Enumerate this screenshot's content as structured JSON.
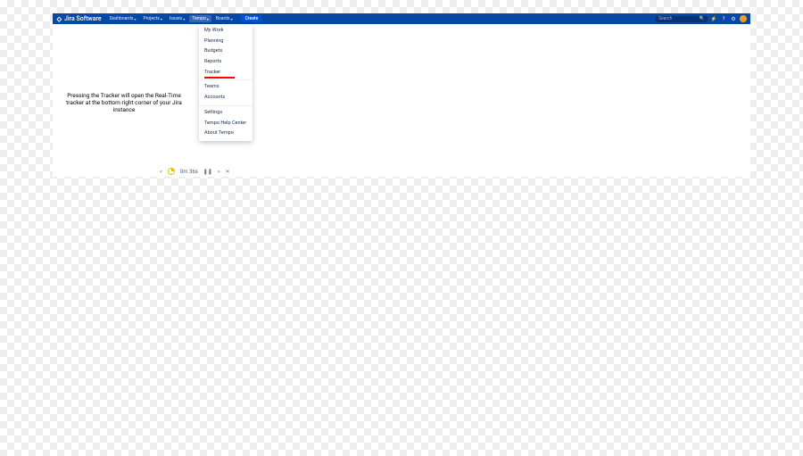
{
  "brand": "Jira Software",
  "nav": {
    "dashboards": "Dashboards",
    "projects": "Projects",
    "issues": "Issues",
    "tempo": "Tempo",
    "boards": "Boards"
  },
  "create": "Create",
  "search": {
    "placeholder": "Search"
  },
  "dropdown": {
    "my_work": "My Work",
    "planning": "Planning",
    "budgets": "Budgets",
    "reports": "Reports",
    "tracker": "Tracker",
    "teams": "Teams",
    "accounts": "Accounts",
    "settings": "Settings",
    "help_center": "Tempo Help Center",
    "about": "About Tempo"
  },
  "caption": "Pressing the Tracker will open the Real-Time tracker at the bottom right corner of your Jira instance",
  "playback": {
    "time": "0m 36s"
  }
}
